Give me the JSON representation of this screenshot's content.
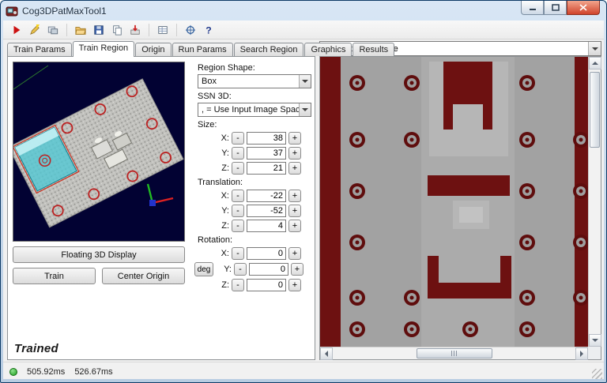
{
  "window": {
    "title": "Cog3DPatMaxTool1"
  },
  "toolbar": {
    "icons": [
      "run-icon",
      "train-icon",
      "tool-edit-icon",
      "open-icon",
      "save-icon",
      "copy-icon",
      "import-icon",
      "results-table-icon",
      "position-tool-icon",
      "help-icon"
    ],
    "help_glyph": "?"
  },
  "tabs": [
    "Train Params",
    "Train Region",
    "Origin",
    "Run Params",
    "Search Region",
    "Graphics",
    "Results"
  ],
  "selected_tab": "Train Region",
  "left_panel": {
    "floating_3d_button": "Floating 3D Display",
    "train_button": "Train",
    "center_origin_button": "Center Origin",
    "status_text": "Trained"
  },
  "form": {
    "region_shape_label": "Region Shape:",
    "region_shape_value": "Box",
    "ssn3d_label": "SSN 3D:",
    "ssn3d_value": ", = Use Input Image Space",
    "size_label": "Size:",
    "translation_label": "Translation:",
    "rotation_label": "Rotation:",
    "axis": {
      "x": "X:",
      "y": "Y:",
      "z": "Z:"
    },
    "stepper": {
      "minus": "-",
      "plus": "+"
    },
    "deg_label": "deg",
    "size": {
      "x": "38",
      "y": "37",
      "z": "21"
    },
    "translation": {
      "x": "-22",
      "y": "-52",
      "z": "4"
    },
    "rotation": {
      "x": "0",
      "y": "0",
      "z": "0"
    }
  },
  "image_panel": {
    "selector_value": "Current.InputImage"
  },
  "statusbar": {
    "time1": "505.92ms",
    "time2": "526.67ms"
  },
  "colors": {
    "image_maroon": "#6d1111",
    "image_gray": "#a2a2a2",
    "view3d_background": "#020233",
    "region_cyan": "#4fc8d4",
    "status_green": "#1f9e1f",
    "run_red": "#cc1111"
  }
}
